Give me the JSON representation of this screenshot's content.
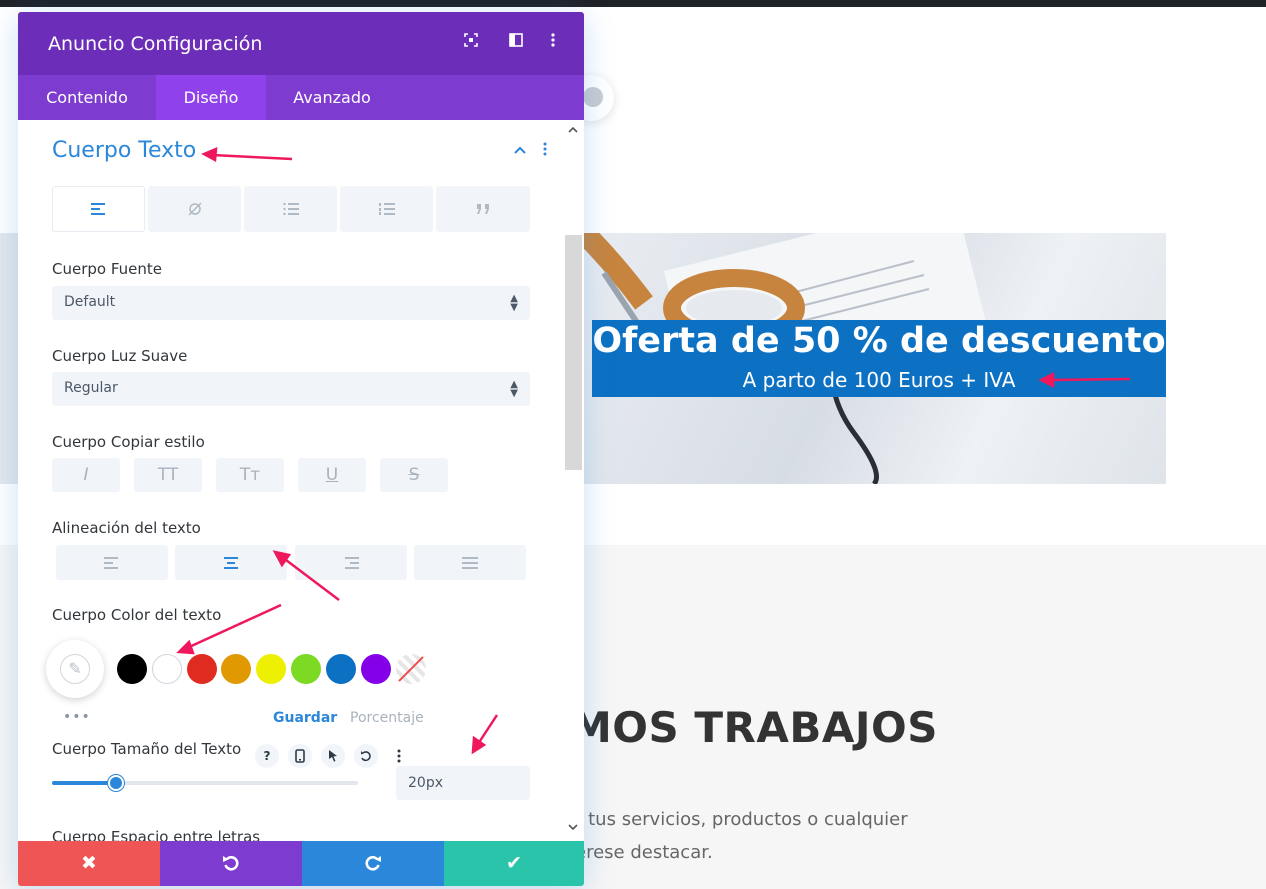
{
  "modal": {
    "title": "Anuncio Configuración",
    "tabs": [
      "Contenido",
      "Diseño",
      "Avanzado"
    ],
    "active_tab": "Diseño",
    "section_title": "Cuerpo Texto",
    "fields": {
      "font_label": "Cuerpo Fuente",
      "font_value": "Default",
      "weight_label": "Cuerpo Luz Suave",
      "weight_value": "Regular",
      "style_label": "Cuerpo Copiar estilo",
      "style_buttons": [
        "I",
        "TT",
        "Tт",
        "U",
        "S"
      ],
      "align_label": "Alineación del texto",
      "active_alignment": "center",
      "color_label": "Cuerpo Color del texto",
      "color_swatches": [
        "#000000",
        "#ffffff",
        "#e02b20",
        "#e09900",
        "#edf000",
        "#7cda24",
        "#0c71c3",
        "#8300e9"
      ],
      "palette_dots": "•••",
      "save_label": "Guardar",
      "percent_label": "Porcentaje",
      "size_label": "Cuerpo Tamaño del Texto",
      "size_help": "?",
      "size_value": "20px",
      "size_slider_fraction": 0.21,
      "next_label": "Cuerpo Espacio entre letras"
    },
    "colors": {
      "header": "#6c2eb9",
      "tabs": "#7e3bd0",
      "accent": "#2b87da",
      "cancel": "#ef5555",
      "undo": "#7e3bd0",
      "redo": "#2b87da",
      "save": "#29c4a9"
    }
  },
  "page": {
    "banner_title": "Oferta de 50 % de descuento",
    "banner_subtitle": "A parto de 100 Euros + IVA",
    "works_heading": "MOS TRABAJOS",
    "works_text_1": "r tus servicios, productos o cualquier",
    "works_text_2": "erese destacar."
  }
}
